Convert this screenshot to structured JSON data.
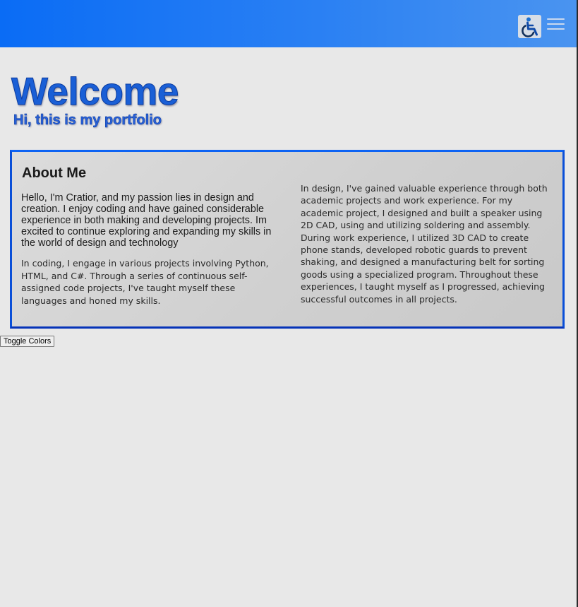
{
  "header": {
    "accessibility_icon": "wheelchair-icon",
    "menu_icon": "hamburger-menu-icon"
  },
  "hero": {
    "title": "Welcome",
    "subtitle": "Hi, this is my portfolio"
  },
  "about": {
    "heading": "About Me",
    "intro": "Hello, I'm Cratior, and my passion lies in design and creation. I enjoy coding and have gained considerable experience in both making and developing projects. Im excited to continue exploring and expanding my skills in the world of design and technology",
    "coding": "In coding, I engage in various projects involving Python, HTML, and C#. Through a series of continuous self-assigned code projects, I've taught myself these languages and honed my skills.",
    "design": "In design, I've gained valuable experience through both academic projects and work experience. For my academic project, I designed and built a speaker using 2D CAD, using and utilizing soldering and assembly. During work experience, I utilized 3D CAD to create phone stands, developed robotic guards to prevent shaking, and designed a manufacturing belt for sorting goods using a specialized program. Throughout these experiences, I taught myself as I progressed, achieving successful outcomes in all projects."
  },
  "controls": {
    "toggle_label": "Toggle Colors"
  },
  "colors": {
    "header_start": "#0a6cf5",
    "header_end": "#4a94f0",
    "title": "#1a5fd6",
    "panel_border": "#0d63f3",
    "page_bg": "#e8e8e8"
  }
}
